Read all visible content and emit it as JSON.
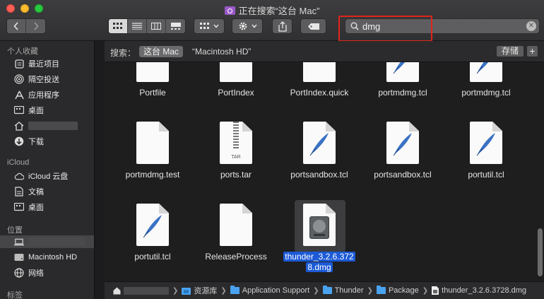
{
  "window": {
    "title": "正在搜索“这台 Mac”"
  },
  "toolbar": {
    "back_icon": "chevron-left-icon",
    "forward_icon": "chevron-right-icon",
    "view_modes": [
      "icon-view",
      "list-view",
      "column-view",
      "gallery-view"
    ],
    "active_view": "icon-view"
  },
  "search": {
    "value": "dmg",
    "placeholder": "搜索"
  },
  "scope": {
    "label": "搜索：",
    "this_mac": "这台 Mac",
    "volume": "“Macintosh HD”",
    "save_label": "存储",
    "add_label": "+"
  },
  "sidebar": {
    "favorites_header": "个人收藏",
    "favorites": [
      {
        "label": "最近项目",
        "icon": "clock-icon"
      },
      {
        "label": "隔空投送",
        "icon": "airdrop-icon"
      },
      {
        "label": "应用程序",
        "icon": "applications-icon"
      },
      {
        "label": "桌面",
        "icon": "desktop-icon"
      },
      {
        "label": "",
        "icon": "home-icon"
      },
      {
        "label": "下载",
        "icon": "download-icon"
      }
    ],
    "icloud_header": "iCloud",
    "icloud": [
      {
        "label": "iCloud 云盘",
        "icon": "cloud-icon"
      },
      {
        "label": "文稿",
        "icon": "document-icon"
      },
      {
        "label": "桌面",
        "icon": "desktop-icon"
      }
    ],
    "locations_header": "位置",
    "locations": [
      {
        "label": "",
        "icon": "laptop-icon"
      },
      {
        "label": "Macintosh HD",
        "icon": "disk-icon"
      },
      {
        "label": "网络",
        "icon": "network-icon"
      }
    ],
    "tags_header": "标签"
  },
  "files": {
    "row1": [
      "Portfile",
      "PortIndex",
      "PortIndex.quick",
      "portmdmg.tcl",
      "portmdmg.tcl"
    ],
    "row2": [
      "portmdmg.test",
      "ports.tar",
      "portsandbox.tcl",
      "portsandbox.tcl",
      "portutil.tcl"
    ],
    "row3": [
      "portutil.tcl",
      "ReleaseProcess",
      "thunder_3.2.6.3728.dmg"
    ],
    "selected_line1": "thunder_3.2.6.372",
    "selected_line2": "8.dmg",
    "tar_label": "TAR"
  },
  "pathbar": {
    "items": [
      "资源库",
      "Application Support",
      "Thunder",
      "Package",
      "thunder_3.2.6.3728.dmg"
    ]
  },
  "colors": {
    "selection": "#1c5ad6",
    "highlight_box": "#e0251c",
    "folder": "#4aa3f0"
  }
}
